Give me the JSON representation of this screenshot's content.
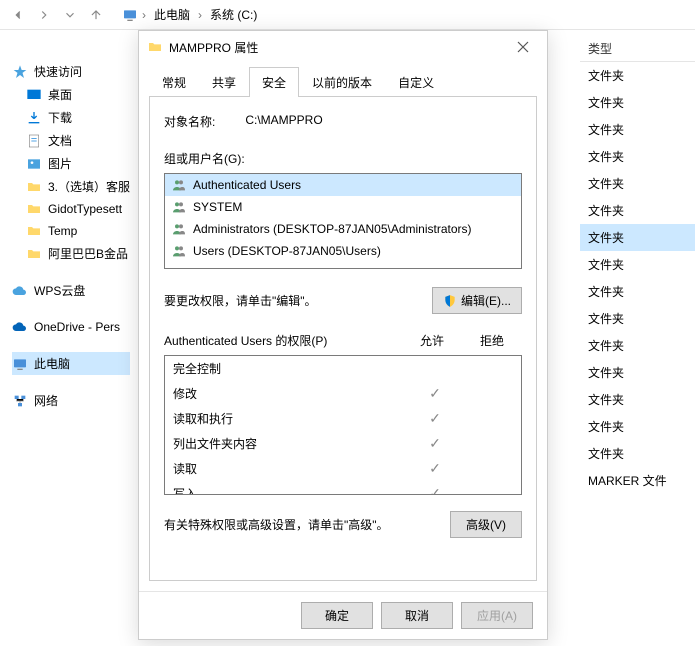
{
  "toolbar": {
    "breadcrumb": [
      "此电脑",
      "系统 (C:)"
    ]
  },
  "sidebar": {
    "quick_access": "快速访问",
    "quick_items": [
      {
        "label": "桌面"
      },
      {
        "label": "下载"
      },
      {
        "label": "文档"
      },
      {
        "label": "图片"
      },
      {
        "label": "3.（选填）客服"
      },
      {
        "label": "GidotTypesett"
      },
      {
        "label": "Temp"
      },
      {
        "label": "阿里巴巴B金品"
      }
    ],
    "wps": "WPS云盘",
    "onedrive": "OneDrive - Pers",
    "this_pc": "此电脑",
    "network": "网络"
  },
  "right": {
    "header": "类型",
    "rows": [
      "文件夹",
      "文件夹",
      "文件夹",
      "文件夹",
      "文件夹",
      "文件夹",
      "文件夹",
      "文件夹",
      "文件夹",
      "文件夹",
      "文件夹",
      "文件夹",
      "文件夹",
      "文件夹",
      "文件夹",
      "MARKER 文件"
    ],
    "selected_index": 6
  },
  "dialog": {
    "title": "MAMPPRO 属性",
    "tabs": {
      "general": "常规",
      "share": "共享",
      "security": "安全",
      "prev": "以前的版本",
      "custom": "自定义"
    },
    "object_label": "对象名称:",
    "object_value": "C:\\MAMPPRO",
    "groups_label": "组或用户名(G):",
    "users": [
      "Authenticated Users",
      "SYSTEM",
      "Administrators (DESKTOP-87JAN05\\Administrators)",
      "Users (DESKTOP-87JAN05\\Users)"
    ],
    "edit_text": "要更改权限，请单击\"编辑\"。",
    "edit_btn": "编辑(E)...",
    "perm_header_name": "Authenticated Users 的权限(P)",
    "perm_allow": "允许",
    "perm_deny": "拒绝",
    "perms": [
      {
        "name": "完全控制",
        "allow": false
      },
      {
        "name": "修改",
        "allow": true
      },
      {
        "name": "读取和执行",
        "allow": true
      },
      {
        "name": "列出文件夹内容",
        "allow": true
      },
      {
        "name": "读取",
        "allow": true
      },
      {
        "name": "写入",
        "allow": true
      }
    ],
    "adv_text": "有关特殊权限或高级设置，请单击\"高级\"。",
    "adv_btn": "高级(V)",
    "ok": "确定",
    "cancel": "取消",
    "apply": "应用(A)"
  }
}
